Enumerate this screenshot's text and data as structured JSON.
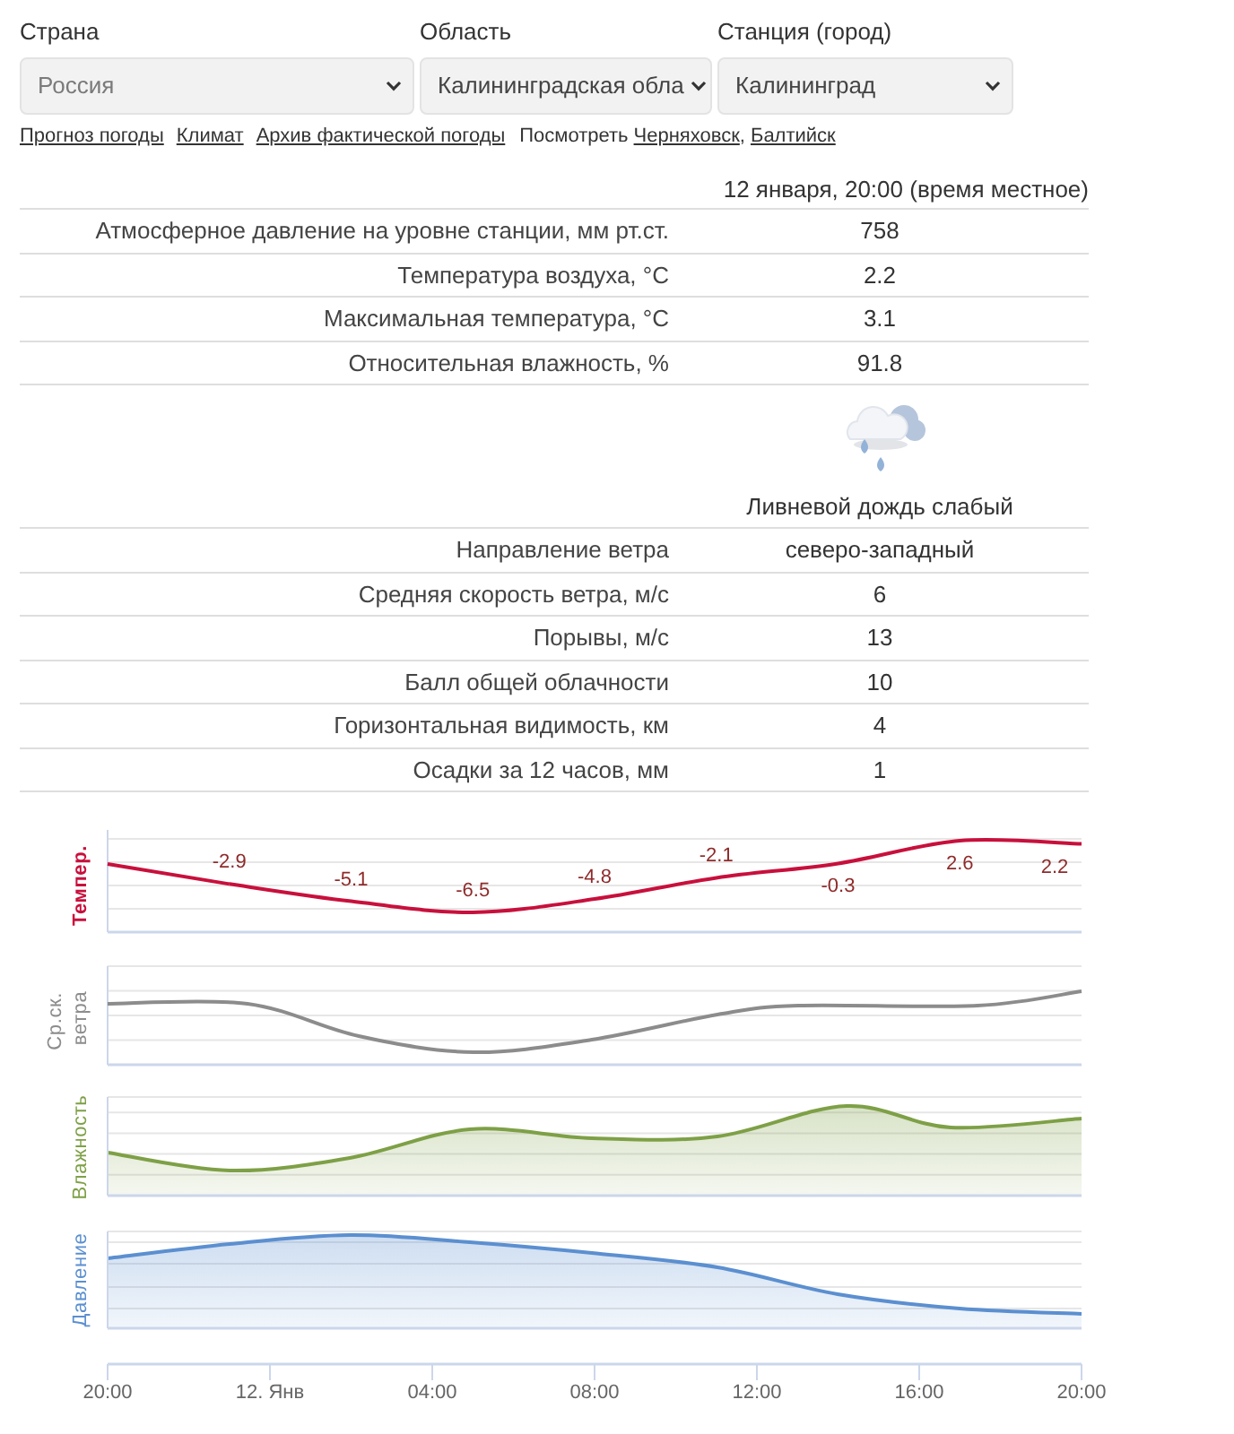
{
  "filters": [
    {
      "label": "Страна",
      "value": "Россия",
      "disabled": true
    },
    {
      "label": "Область",
      "value": "Калининградская обла",
      "disabled": false
    },
    {
      "label": "Станция (город)",
      "value": "Калининград",
      "disabled": false
    }
  ],
  "links": [
    "Прогноз погоды",
    "Климат",
    "Архив фактической погоды"
  ],
  "see_also": {
    "label": "Посмотреть",
    "links": [
      "Черняховск",
      "Балтийск"
    ],
    "separator": ","
  },
  "observation": {
    "time": "12 января, 20:00 (время местное)",
    "rows": [
      {
        "kind": "value",
        "label": "Атмосферное давление на уровне станции, мм рт.ст.",
        "value": "758"
      },
      {
        "kind": "value",
        "label": "Температура воздуха, °C",
        "value": "2.2"
      },
      {
        "kind": "value",
        "label": "Максимальная температура, °C",
        "value": "3.1"
      },
      {
        "kind": "value",
        "label": "Относительная влажность, %",
        "value": "91.8"
      },
      {
        "kind": "weather",
        "value": "Ливневой дождь слабый"
      },
      {
        "kind": "value",
        "label": "Направление ветра",
        "value": "северо-западный"
      },
      {
        "kind": "value",
        "label": "Средняя скорость ветра, м/с",
        "value": "6"
      },
      {
        "kind": "value",
        "label": "Порывы, м/с",
        "value": "13"
      },
      {
        "kind": "value",
        "label": "Балл общей облачности",
        "value": "10"
      },
      {
        "kind": "value",
        "label": "Горизонтальная видимость, км",
        "value": "4"
      },
      {
        "kind": "value",
        "label": "Осадки за 12 часов, мм",
        "value": "1"
      }
    ]
  },
  "charts": {
    "panels": [
      {
        "kind": "temperature",
        "chart_data": {
          "type": "line",
          "ylabel": "Темпер.",
          "categories": [
            "20:00",
            null,
            null,
            null,
            "12. Янв",
            null,
            null,
            null,
            "04:00",
            null,
            null,
            null,
            "08:00",
            null,
            null,
            null,
            "12:00",
            null,
            null,
            null,
            "16:00",
            null,
            null,
            null,
            "20:00"
          ],
          "series": [
            {
              "color": "#c8103c",
              "values": [
                null,
                null,
                null,
                -2.9,
                null,
                null,
                -5.1,
                null,
                null,
                -6.5,
                null,
                null,
                -4.8,
                null,
                null,
                -2.1,
                null,
                null,
                -0.3,
                null,
                null,
                2.6,
                null,
                null,
                2.2
              ]
            }
          ],
          "data_labels": true
        }
      },
      {
        "kind": "wind",
        "title": "Ср.ск. ветра",
        "color": "#8c8c8c"
      },
      {
        "kind": "humidity",
        "title": "Влажность",
        "color": "#7ea046"
      },
      {
        "kind": "pressure",
        "title": "Давление",
        "color": "#5b8fd0"
      }
    ]
  }
}
